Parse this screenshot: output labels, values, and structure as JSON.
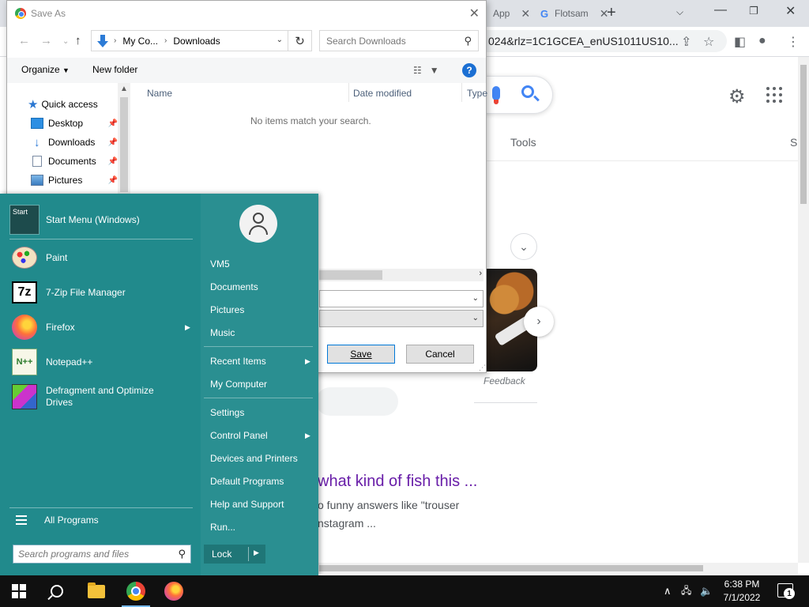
{
  "browser": {
    "tabs": [
      {
        "label": "App",
        "icon": "app-icon"
      },
      {
        "label": "Flotsam",
        "icon": "google-icon"
      }
    ],
    "new_tab": "+",
    "url": "024&rlz=1C1GCEA_enUS1011US10...",
    "google": {
      "tools_label": "Tools",
      "s_cut": "S",
      "feedback": "Feedback",
      "result_title": "what kind of fish this ...",
      "result_snippet_1": "o funny answers like \"trouser",
      "result_snippet_2": "nstagram ..."
    }
  },
  "dialog": {
    "title": "Save As",
    "breadcrumb": [
      "My Co...",
      "Downloads"
    ],
    "search_placeholder": "Search Downloads",
    "organize": "Organize",
    "new_folder": "New folder",
    "help": "?",
    "nav_items": [
      {
        "label": "Quick access",
        "icon": "star-icon"
      },
      {
        "label": "Desktop",
        "icon": "desktop-icon",
        "pinned": true
      },
      {
        "label": "Downloads",
        "icon": "downloads-icon",
        "pinned": true
      },
      {
        "label": "Documents",
        "icon": "documents-icon",
        "pinned": true
      },
      {
        "label": "Pictures",
        "icon": "pictures-icon",
        "pinned": true
      }
    ],
    "columns": [
      "Name",
      "Date modified",
      "Type"
    ],
    "empty_message": "No items match your search.",
    "save_label": "Save",
    "cancel_label": "Cancel"
  },
  "start_menu": {
    "pinned": [
      {
        "label": "Start Menu (Windows)",
        "icon": "start-menu-icon"
      },
      {
        "label": "Paint",
        "icon": "paint-icon"
      },
      {
        "label": "7-Zip File Manager",
        "icon": "7zip-icon"
      },
      {
        "label": "Firefox",
        "icon": "firefox-icon",
        "submenu": true
      },
      {
        "label": "Notepad++",
        "icon": "notepadpp-icon"
      },
      {
        "label": "Defragment and Optimize Drives",
        "icon": "defrag-icon"
      }
    ],
    "all_programs": "All Programs",
    "search_placeholder": "Search programs and files",
    "right_items": [
      {
        "label": "VM5"
      },
      {
        "label": "Documents"
      },
      {
        "label": "Pictures"
      },
      {
        "label": "Music"
      },
      {
        "label": "Recent Items",
        "submenu": true
      },
      {
        "label": "My Computer"
      },
      {
        "label": "Settings"
      },
      {
        "label": "Control Panel",
        "submenu": true
      },
      {
        "label": "Devices and Printers"
      },
      {
        "label": "Default Programs"
      },
      {
        "label": "Help and Support"
      },
      {
        "label": "Run..."
      }
    ],
    "lock_label": "Lock",
    "colors": {
      "left": "#218a8c",
      "right": "#2a8f91"
    }
  },
  "taskbar": {
    "time": "6:38 PM",
    "date": "7/1/2022",
    "notification_count": "1"
  }
}
